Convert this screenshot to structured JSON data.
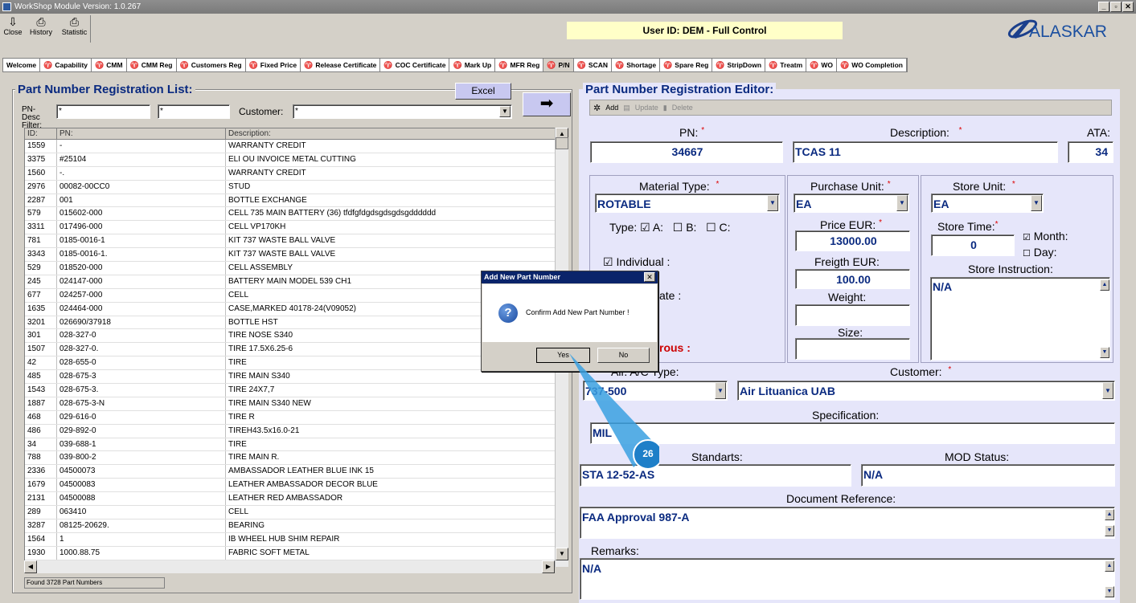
{
  "window": {
    "title": "WorkShop Module  Version: 1.0.267",
    "controls": [
      "_",
      "▫",
      "✕"
    ]
  },
  "toolbar": {
    "buttons": [
      {
        "label": "Close",
        "icon": "close-door-icon"
      },
      {
        "label": "History",
        "icon": "printer-icon"
      },
      {
        "label": "Statistic",
        "icon": "printer-icon"
      }
    ]
  },
  "user": {
    "text": "User ID: DEM - Full Control"
  },
  "logo": {
    "text": "ALASKAR"
  },
  "tabs": [
    "Welcome",
    "Capability",
    "CMM",
    "CMM Reg",
    "Customers Reg",
    "Fixed Price",
    "Release Certificate",
    "COC Certificate",
    "Mark Up",
    "MFR Reg",
    "P/N",
    "SCAN",
    "Shortage",
    "Spare Reg",
    "StripDown",
    "Treatm",
    "WO",
    "WO Completion"
  ],
  "active_tab": "P/N",
  "list": {
    "title": "Part Number Registration List:",
    "excel_label": "Excel",
    "filter_label": "PN- Desc Filter:",
    "filter1": "*",
    "filter2": "*",
    "customer_label": "Customer:",
    "customer_value": "*",
    "headers": [
      "ID:",
      "PN:",
      "Description:"
    ],
    "rows": [
      [
        "1559",
        "-",
        "WARRANTY CREDIT"
      ],
      [
        "3375",
        "#25104",
        "ELI OU INVOICE METAL CUTTING"
      ],
      [
        "1560",
        "-.",
        "WARRANTY CREDIT"
      ],
      [
        "2976",
        "00082-00CC0",
        "STUD"
      ],
      [
        "2287",
        "001",
        "BOTTLE EXCHANGE"
      ],
      [
        "579",
        "015602-000",
        "CELL 735 MAIN BATTERY (36) tfdfgfdgdsgdsgdsgdddddd"
      ],
      [
        "3311",
        "017496-000",
        "CELL VP170KH"
      ],
      [
        "781",
        "0185-0016-1",
        "KIT 737 WASTE BALL VALVE"
      ],
      [
        "3343",
        "0185-0016-1.",
        "KIT 737 WASTE BALL VALVE"
      ],
      [
        "529",
        "018520-000",
        "CELL ASSEMBLY"
      ],
      [
        "245",
        "024147-000",
        "BATTERY MAIN MODEL 539 CH1"
      ],
      [
        "677",
        "024257-000",
        "CELL"
      ],
      [
        "1635",
        "024464-000",
        "CASE,MARKED 40178-24(V09052)"
      ],
      [
        "3201",
        "026690/37918",
        "BOTTLE HST"
      ],
      [
        "301",
        "028-327-0",
        "TIRE NOSE S340"
      ],
      [
        "1507",
        "028-327-0.",
        "TIRE 17.5X6.25-6"
      ],
      [
        "42",
        "028-655-0",
        "TIRE"
      ],
      [
        "485",
        "028-675-3",
        "TIRE MAIN S340"
      ],
      [
        "1543",
        "028-675-3.",
        "TIRE 24X7,7"
      ],
      [
        "1887",
        "028-675-3-N",
        "TIRE MAIN S340 NEW"
      ],
      [
        "468",
        "029-616-0",
        "TIRE R"
      ],
      [
        "486",
        "029-892-0",
        "TIREH43.5x16.0-21"
      ],
      [
        "34",
        "039-688-1",
        "TIRE"
      ],
      [
        "788",
        "039-800-2",
        "TIRE MAIN  R."
      ],
      [
        "2336",
        "04500073",
        "AMBASSADOR LEATHER BLUE INK 15"
      ],
      [
        "1679",
        "04500083",
        "LEATHER AMBASSADOR DECOR BLUE"
      ],
      [
        "2131",
        "04500088",
        "LEATHER RED AMBASSADOR"
      ],
      [
        "289",
        "063410",
        "CELL"
      ],
      [
        "3287",
        "08125-20629.",
        "BEARING"
      ],
      [
        "1564",
        "1",
        "IB WHEEL HUB SHIM REPAIR"
      ],
      [
        "1930",
        "1000.88.75",
        "FABRIC SOFT METAL"
      ]
    ],
    "status": "Found 3728 Part Numbers"
  },
  "editor": {
    "title": "Part Number Registration Editor:",
    "toolbar": {
      "add": "Add",
      "update": "Update",
      "delete": "Delete"
    },
    "pn_label": "PN:",
    "pn_value": "34667",
    "desc_label": "Description:",
    "desc_value": "TCAS 11",
    "ata_label": "ATA:",
    "ata_value": "34",
    "material_label": "Material Type:",
    "material_value": "ROTABLE",
    "type_label": "Type:",
    "type_a": "A:",
    "type_b": "B:",
    "type_c": "C:",
    "individual_label": "Individual :",
    "ate_label": "ate :",
    "rous_label": "rous :",
    "purchase_label": "Purchase Unit:",
    "purchase_value": "EA",
    "price_label": "Price EUR:",
    "price_value": "13000.00",
    "freight_label": "Freigth EUR:",
    "freight_value": "100.00",
    "weight_label": "Weight:",
    "size_label": "Size:",
    "store_label": "Store Unit:",
    "store_value": "EA",
    "storetime_label": "Store Time:",
    "storetime_value": "0",
    "month_label": "Month:",
    "day_label": "Day:",
    "storeinstr_label": "Store Instruction:",
    "storeinstr_value": "N/A",
    "actype_label": "Air. A/C Type:",
    "actype_value": "737-500",
    "customer_label": "Customer:",
    "customer_value": "Air Lituanica UAB",
    "spec_label": "Specification:",
    "spec_value": "MIL",
    "standarts_label": "Standarts:",
    "standarts_value": "STA 12-52-AS",
    "mod_label": "MOD Status:",
    "mod_value": "N/A",
    "docref_label": "Document Reference:",
    "docref_value": "FAA Approval 987-A",
    "remarks_label": "Remarks:",
    "remarks_value": "N/A"
  },
  "dialog": {
    "title": "Add New Part Number",
    "message": "Confirm Add New Part Number !",
    "yes": "Yes",
    "no": "No"
  },
  "callout": {
    "number": "26"
  }
}
